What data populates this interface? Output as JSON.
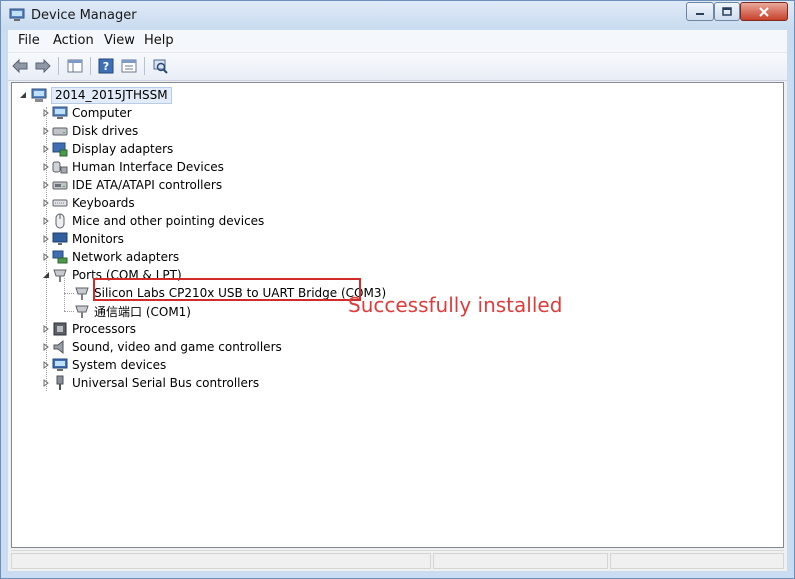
{
  "window": {
    "title": "Device Manager",
    "accent_color": "#c9dcf1",
    "close_color": "#c7402a"
  },
  "menu": {
    "file": "File",
    "action": "Action",
    "view": "View",
    "help": "Help"
  },
  "toolbar": {
    "buttons": [
      "back-icon",
      "forward-icon",
      "show-hide-console-tree-icon",
      "help-icon",
      "properties-icon",
      "scan-hardware-icon"
    ]
  },
  "tree": {
    "root": "2014_2015JTHSSM",
    "categories": [
      {
        "label": "Computer",
        "icon": "computer-icon"
      },
      {
        "label": "Disk drives",
        "icon": "disk-drive-icon"
      },
      {
        "label": "Display adapters",
        "icon": "display-adapter-icon"
      },
      {
        "label": "Human Interface Devices",
        "icon": "hid-icon"
      },
      {
        "label": "IDE ATA/ATAPI controllers",
        "icon": "ide-controller-icon"
      },
      {
        "label": "Keyboards",
        "icon": "keyboard-icon"
      },
      {
        "label": "Mice and other pointing devices",
        "icon": "mouse-icon"
      },
      {
        "label": "Monitors",
        "icon": "monitor-icon"
      },
      {
        "label": "Network adapters",
        "icon": "network-adapter-icon"
      },
      {
        "label": "Ports (COM & LPT)",
        "icon": "port-icon"
      },
      {
        "label": "Processors",
        "icon": "processor-icon"
      },
      {
        "label": "Sound, video and game controllers",
        "icon": "speaker-icon"
      },
      {
        "label": "System devices",
        "icon": "system-device-icon"
      },
      {
        "label": "Universal Serial Bus controllers",
        "icon": "usb-icon"
      }
    ],
    "ports_children": [
      {
        "label": "Silicon Labs CP210x USB to UART Bridge (COM3)",
        "icon": "port-icon"
      },
      {
        "label": "通信端口 (COM1)",
        "icon": "port-icon"
      }
    ]
  },
  "annotation": {
    "text": "Successfully installed",
    "color": "#e03c3c"
  }
}
